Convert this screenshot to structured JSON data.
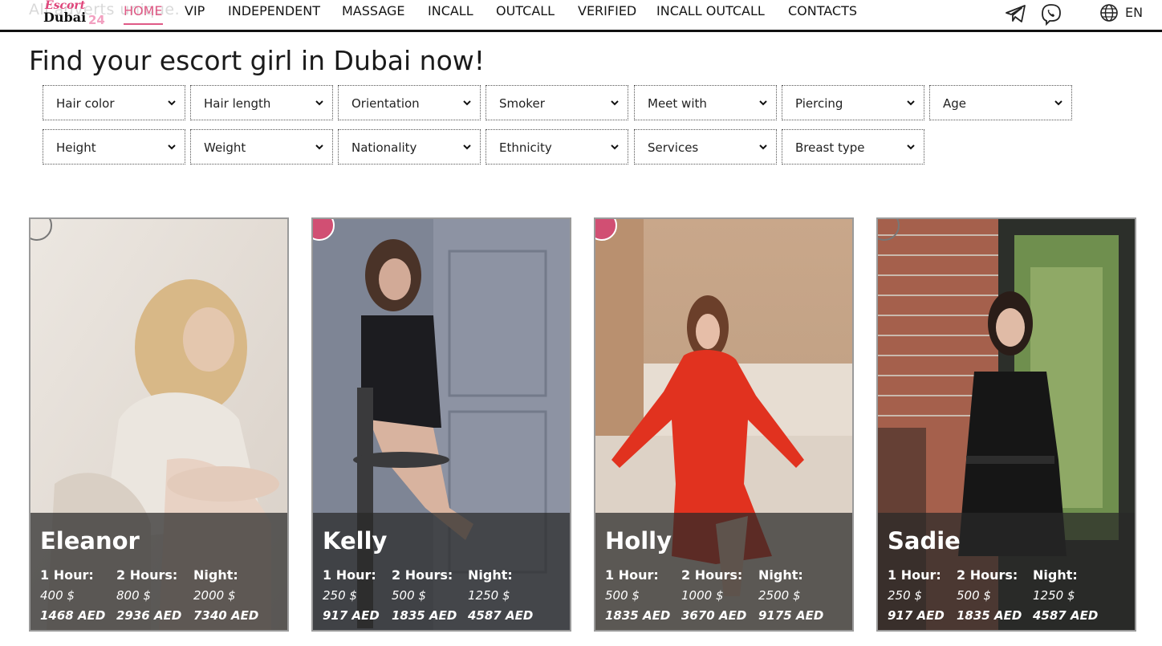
{
  "header": {
    "ghost_text": "All adverts unique.",
    "logo": {
      "line1": "Escort",
      "line2": "Dubai",
      "number": "24"
    },
    "nav": [
      {
        "label": "HOME",
        "active": true
      },
      {
        "label": "VIP"
      },
      {
        "label": "INDEPENDENT"
      },
      {
        "label": "MASSAGE"
      },
      {
        "label": "INCALL"
      },
      {
        "label": "OUTCALL"
      },
      {
        "label": "VERIFIED"
      },
      {
        "label": "INCALL OUTCALL"
      },
      {
        "label": "CONTACTS"
      }
    ],
    "icons": [
      "telegram-icon",
      "viber-icon",
      "globe-icon"
    ],
    "language": "EN",
    "accent_color": "#e05a86"
  },
  "page_title": "Find your escort girl in Dubai now!",
  "filters": {
    "row1": [
      "Hair color",
      "Hair length",
      "Orientation",
      "Smoker",
      "Meet with",
      "Piercing",
      "Age"
    ],
    "row2": [
      "Height",
      "Weight",
      "Nationality",
      "Ethnicity",
      "Services",
      "Breast type"
    ]
  },
  "cards": [
    {
      "name": "Eleanor",
      "prices": [
        {
          "label": "1 Hour:",
          "usd": "400 $",
          "aed": "1468 AED"
        },
        {
          "label": "2 Hours:",
          "usd": "800 $",
          "aed": "2936 AED"
        },
        {
          "label": "Night:",
          "usd": "2000 $",
          "aed": "7340 AED"
        }
      ]
    },
    {
      "name": "Kelly",
      "prices": [
        {
          "label": "1 Hour:",
          "usd": "250 $",
          "aed": "917 AED"
        },
        {
          "label": "2 Hours:",
          "usd": "500 $",
          "aed": "1835 AED"
        },
        {
          "label": "Night:",
          "usd": "1250 $",
          "aed": "4587 AED"
        }
      ]
    },
    {
      "name": "Holly",
      "prices": [
        {
          "label": "1 Hour:",
          "usd": "500 $",
          "aed": "1835 AED"
        },
        {
          "label": "2 Hours:",
          "usd": "1000 $",
          "aed": "3670 AED"
        },
        {
          "label": "Night:",
          "usd": "2500 $",
          "aed": "9175 AED"
        }
      ]
    },
    {
      "name": "Sadie",
      "prices": [
        {
          "label": "1 Hour:",
          "usd": "250 $",
          "aed": "917 AED"
        },
        {
          "label": "2 Hours:",
          "usd": "500 $",
          "aed": "1835 AED"
        },
        {
          "label": "Night:",
          "usd": "1250 $",
          "aed": "4587 AED"
        }
      ]
    }
  ]
}
